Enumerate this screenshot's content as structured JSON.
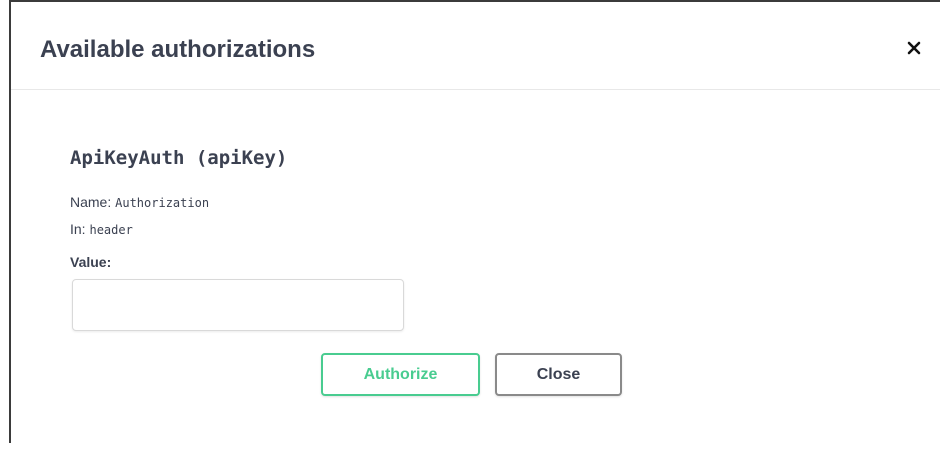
{
  "header": {
    "title": "Available authorizations",
    "close_icon": "close-icon"
  },
  "scheme": {
    "title": "ApiKeyAuth (apiKey)",
    "name_label": "Name:",
    "name_value": "Authorization",
    "in_label": "In:",
    "in_value": "header",
    "value_label": "Value:",
    "value_input": ""
  },
  "buttons": {
    "authorize": "Authorize",
    "close": "Close"
  },
  "colors": {
    "authorize_accent": "#49cc90",
    "text": "#3b4151"
  }
}
